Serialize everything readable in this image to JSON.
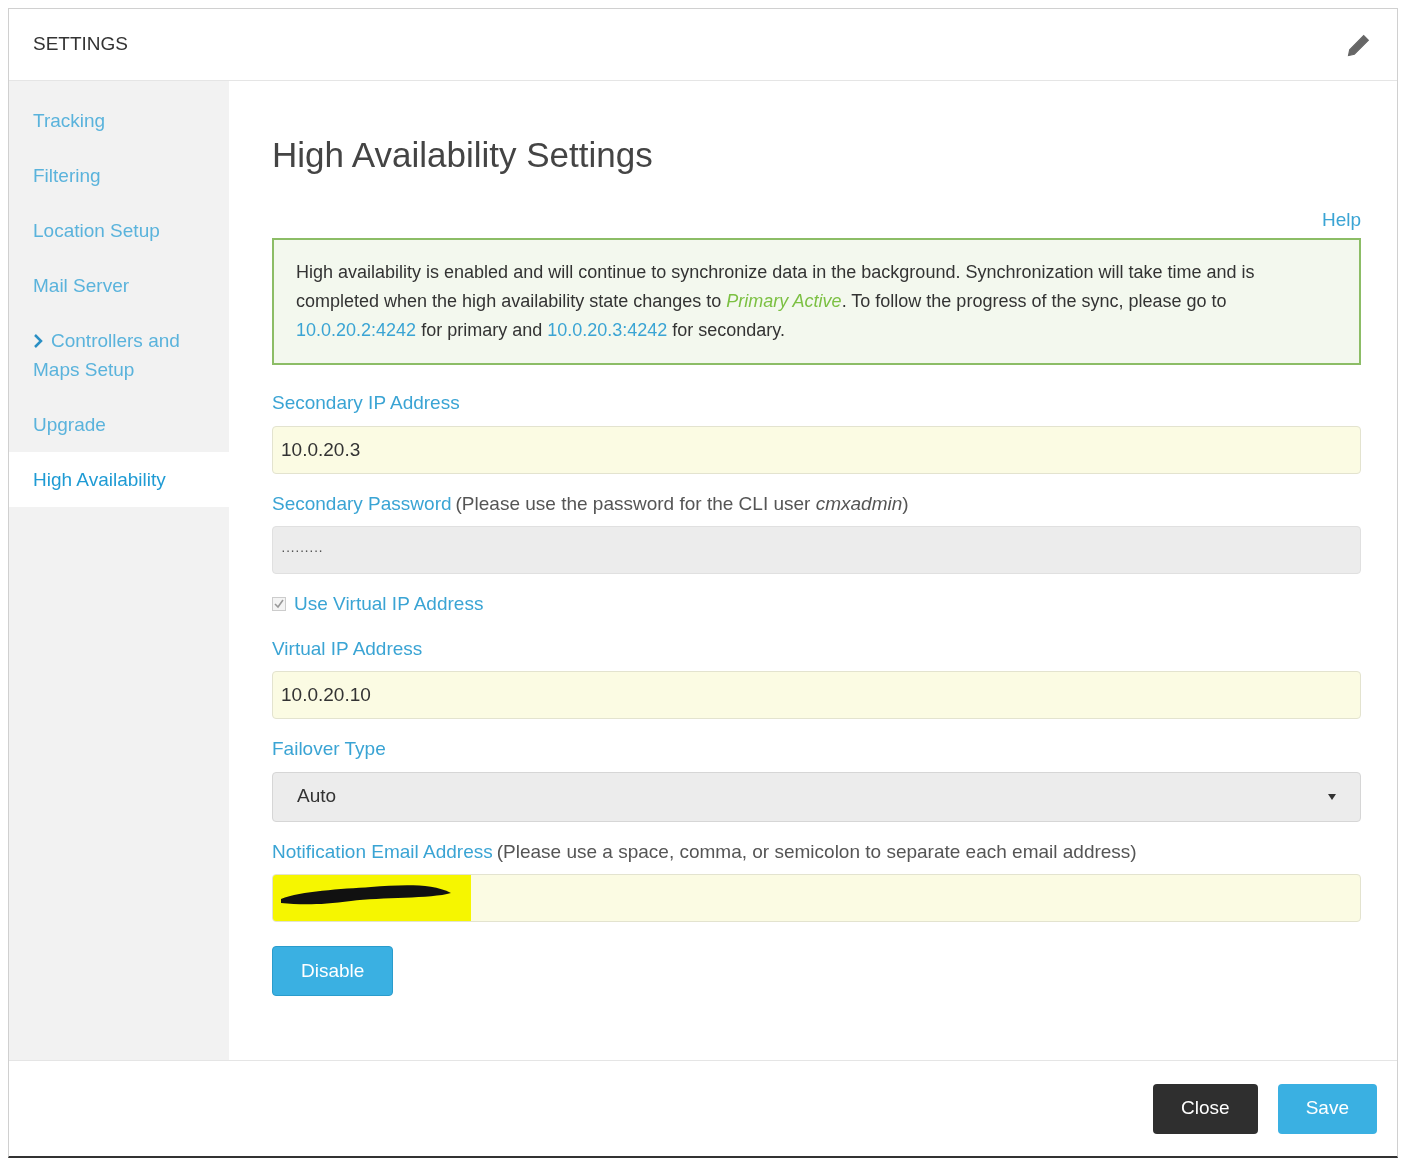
{
  "header": {
    "title": "SETTINGS"
  },
  "sidebar": {
    "items": [
      {
        "label": "Tracking",
        "selected": false,
        "kind": "link"
      },
      {
        "label": "Filtering",
        "selected": false,
        "kind": "link"
      },
      {
        "label": "Location Setup",
        "selected": false,
        "kind": "link"
      },
      {
        "label": "Mail Server",
        "selected": false,
        "kind": "link"
      },
      {
        "label": "Controllers and Maps Setup",
        "selected": false,
        "kind": "group"
      },
      {
        "label": "Upgrade",
        "selected": false,
        "kind": "link"
      },
      {
        "label": "High Availability",
        "selected": true,
        "kind": "link"
      }
    ]
  },
  "content": {
    "title": "High Availability Settings",
    "help": "Help",
    "message": [
      {
        "kind": "text",
        "text": "High availability is enabled and will continue to synchronize data in the background. Synchronization will take time and is completed when the high availability state changes to "
      },
      {
        "kind": "status",
        "text": "Primary Active"
      },
      {
        "kind": "text",
        "text": ". To follow the progress of the sync, please go to "
      },
      {
        "kind": "link",
        "text": "10.0.20.2:4242"
      },
      {
        "kind": "text",
        "text": " for primary and "
      },
      {
        "kind": "link",
        "text": "10.0.20.3:4242"
      },
      {
        "kind": "text",
        "text": " for secondary."
      }
    ],
    "fields": [
      {
        "kind": "input",
        "label": "Secondary IP Address",
        "value": "10.0.20.3"
      },
      {
        "kind": "password",
        "label": "Secondary Password",
        "note": "(Please use the password for the CLI user *cmxadmin*)",
        "value": "·········"
      },
      {
        "kind": "checkbox",
        "label": "Use Virtual IP Address",
        "checked": true
      },
      {
        "kind": "input",
        "label": "Virtual IP Address",
        "value": "10.0.20.10"
      },
      {
        "kind": "select",
        "label": "Failover Type",
        "value": "Auto"
      },
      {
        "kind": "redacted",
        "label": "Notification Email Address",
        "note": "(Please use a space, comma, or semicolon to separate each email address)"
      }
    ],
    "action": "Disable"
  },
  "footer": {
    "buttons": [
      {
        "label": "Close",
        "kind": "dark"
      },
      {
        "label": "Save",
        "kind": "primary"
      }
    ]
  }
}
